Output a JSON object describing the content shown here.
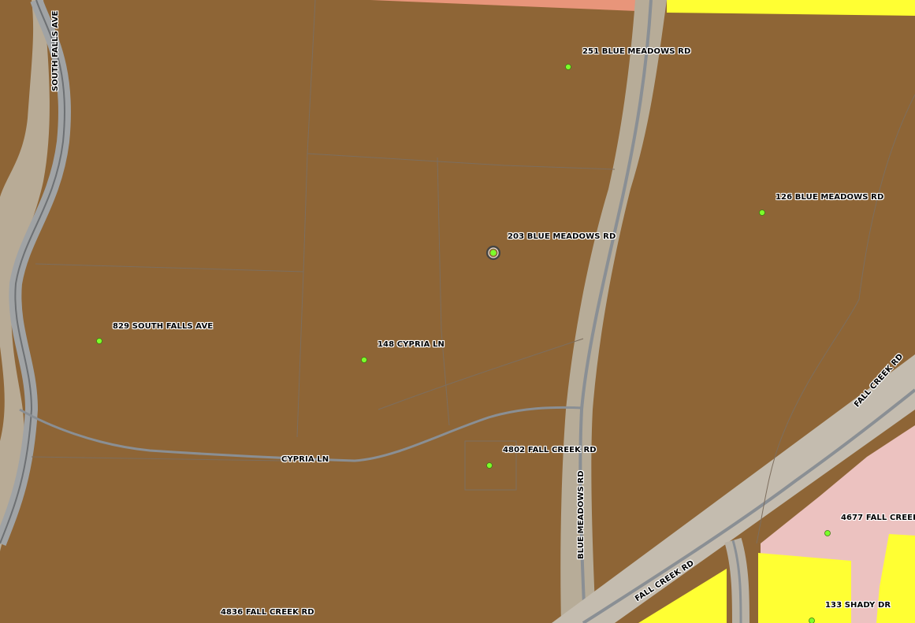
{
  "map": {
    "colors": {
      "parcel_brown": "#8e6536",
      "parcel_line": "#7a6a5a",
      "road_gray": "#8a8f94",
      "aerial_road": "#b9b2a6",
      "salmon_zone": "#e8957a",
      "yellow_zone": "#ffff33",
      "pink_zone": "#ecc2c0",
      "address_point": "#7cff2a",
      "selected_ring": "#555555"
    },
    "address_labels": [
      {
        "text": "251 BLUE MEADOWS RD",
        "icon": "address-point-icon"
      },
      {
        "text": "126 BLUE MEADOWS RD",
        "icon": "address-point-icon"
      },
      {
        "text": "203 BLUE MEADOWS RD",
        "icon": "selected-address-point-icon"
      },
      {
        "text": "829 SOUTH FALLS AVE",
        "icon": "address-point-icon"
      },
      {
        "text": "148 CYPRIA LN",
        "icon": "address-point-icon"
      },
      {
        "text": "4802 FALL CREEK RD",
        "icon": "address-point-icon"
      },
      {
        "text": "4677 FALL CREEK",
        "icon": "address-point-icon"
      },
      {
        "text": "133 SHADY DR",
        "icon": "address-point-icon"
      },
      {
        "text": "4836 FALL CREEK RD",
        "icon": "none"
      }
    ],
    "street_labels": {
      "south_falls_ave": "SOUTH FALLS AVE",
      "cypria_ln": "CYPRIA LN",
      "blue_meadows_rd": "BLUE MEADOWS RD",
      "fall_creek_rd_upper": "FALL CREEK RD",
      "fall_creek_rd_lower": "FALL CREEK RD"
    }
  }
}
